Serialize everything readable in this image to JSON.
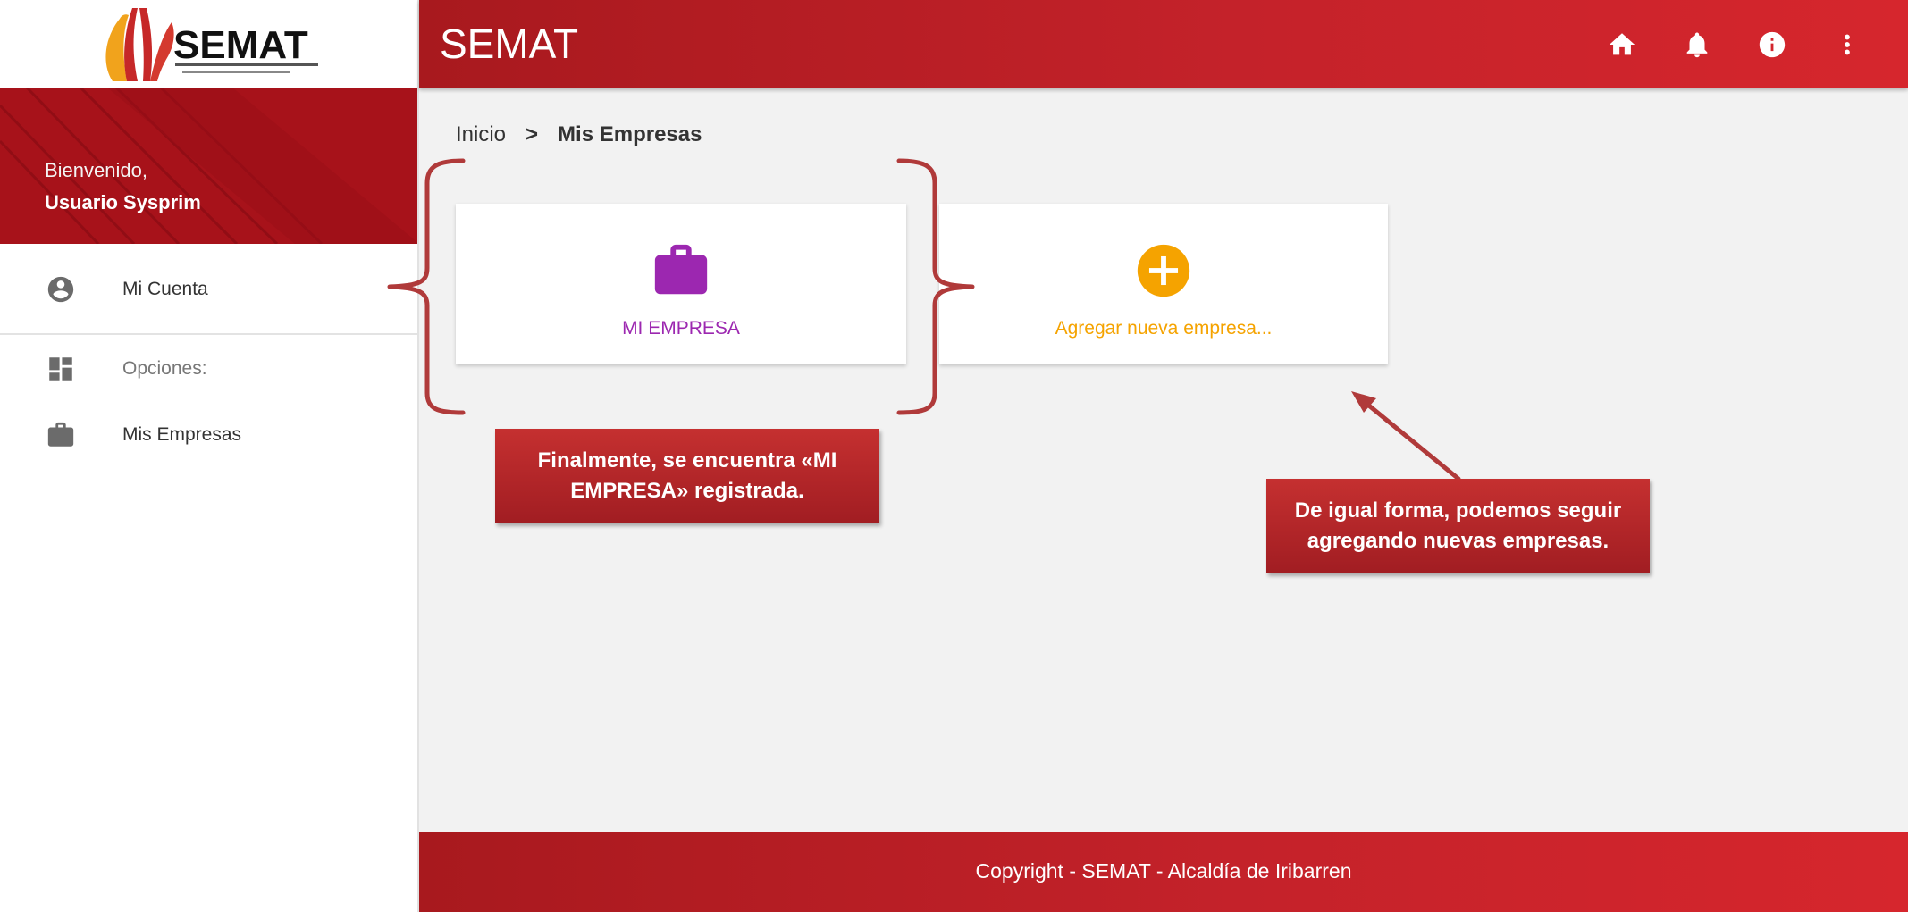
{
  "sidebar": {
    "logo_text": "SEMAT",
    "welcome": "Bienvenido,",
    "username": "Usuario Sysprim",
    "items": [
      {
        "label": "Mi Cuenta",
        "icon": "account-circle-icon"
      },
      {
        "label": "Opciones:",
        "icon": "dashboard-icon"
      },
      {
        "label": "Mis Empresas",
        "icon": "briefcase-icon"
      }
    ]
  },
  "header": {
    "title": "SEMAT",
    "icons": [
      "home-icon",
      "bell-icon",
      "info-icon",
      "more-vert-icon"
    ]
  },
  "breadcrumb": {
    "home": "Inicio",
    "separator": ">",
    "current": "Mis Empresas"
  },
  "cards": [
    {
      "label": "MI EMPRESA",
      "icon": "briefcase-icon",
      "color": "#9c27b0"
    },
    {
      "label": "Agregar nueva empresa...",
      "icon": "add-circle-icon",
      "color": "#f5a300"
    }
  ],
  "annotations": {
    "callout_1": "Finalmente,  se encuentra «MI EMPRESA»  registrada.",
    "callout_2": "De igual forma, podemos seguir agregando nuevas empresas."
  },
  "footer": {
    "copyright": "Copyright - SEMAT - Alcaldía de Iribarren"
  },
  "colors": {
    "brand_red": "#c4222a",
    "sidebar_red": "#a7121a",
    "purple": "#9c27b0",
    "orange": "#f5a300"
  }
}
